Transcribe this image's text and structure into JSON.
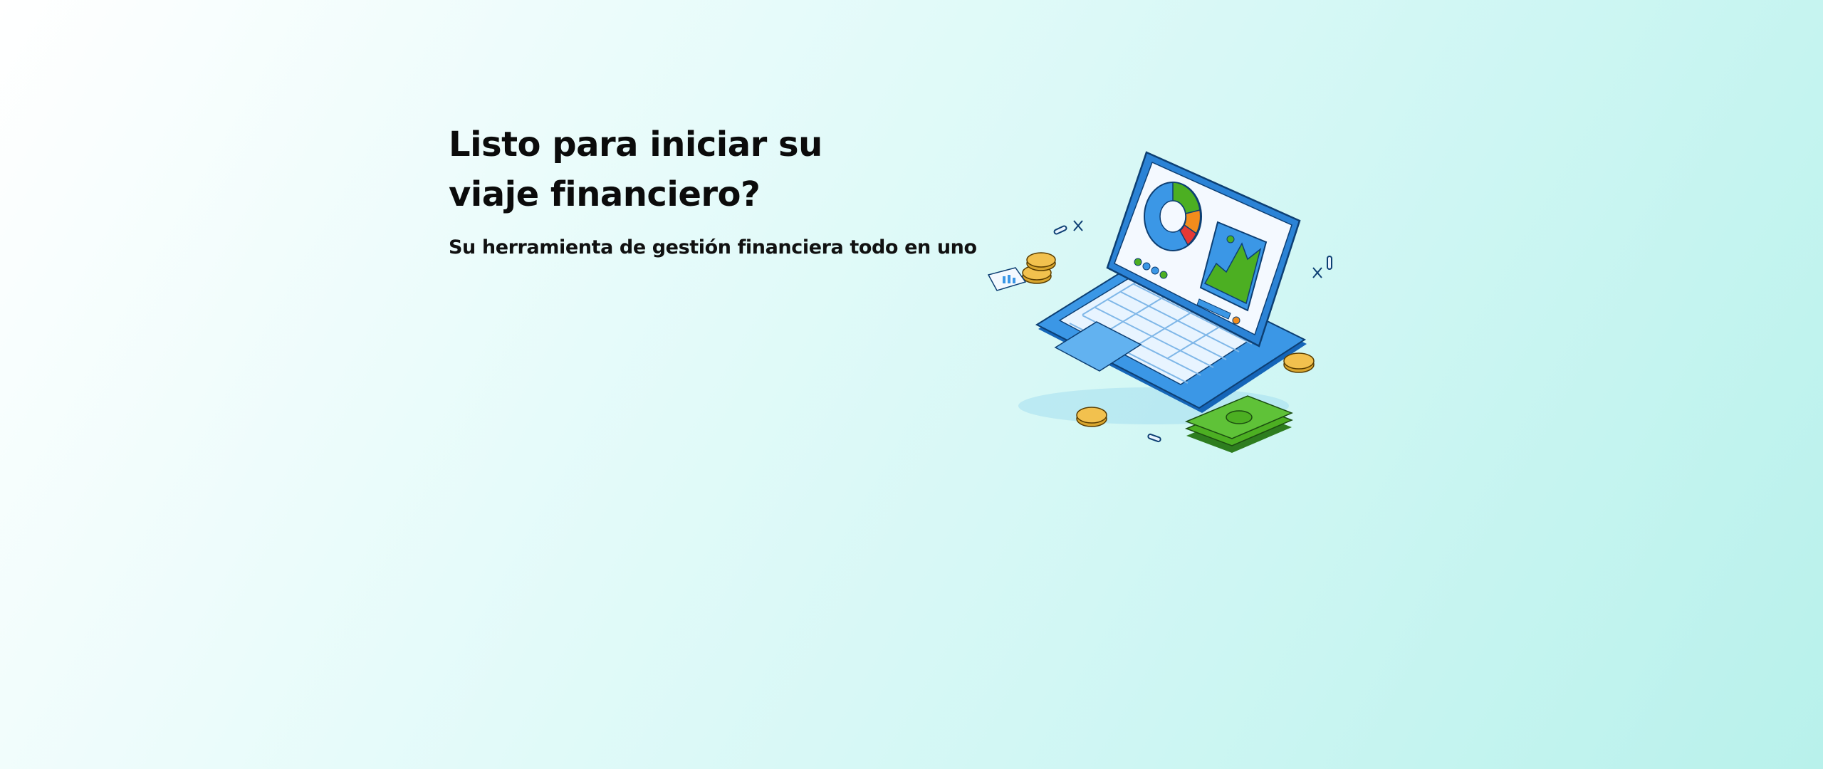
{
  "hero": {
    "title_line1": "Listo para iniciar su",
    "title_line2": "viaje financiero?",
    "subtitle": "Su herramienta de gestión financiera todo en uno",
    "illustration_icon": "laptop-finance-icon"
  },
  "colors": {
    "text": "#0b0b0b",
    "laptop_blue": "#3b97e6",
    "laptop_dark": "#1565b8",
    "accent_green": "#4caf22",
    "accent_orange": "#f28c1c",
    "accent_red": "#e53935",
    "coin_gold": "#f2c14e",
    "cash_green": "#5fc238"
  }
}
